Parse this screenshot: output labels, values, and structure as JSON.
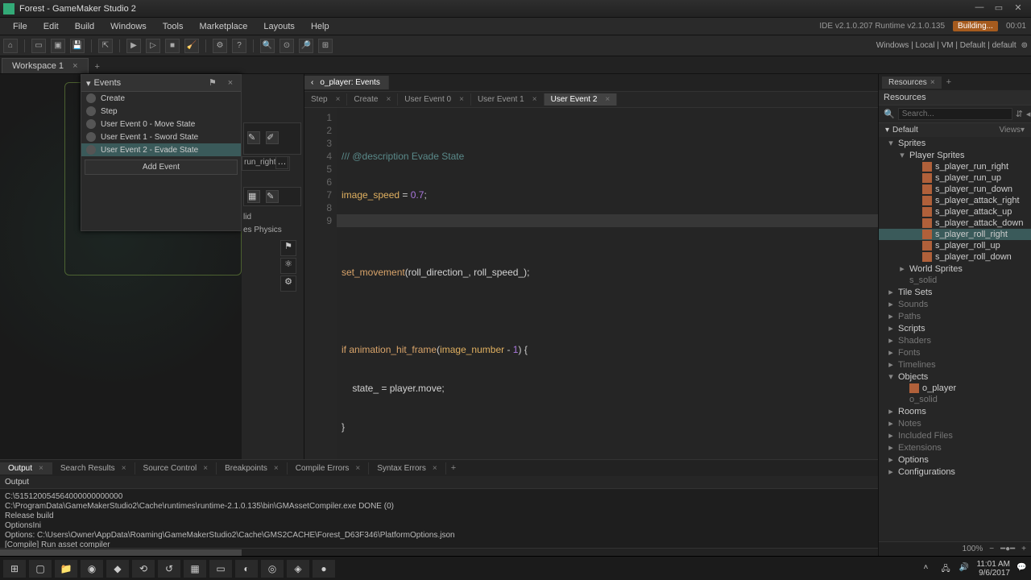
{
  "title": "Forest - GameMaker Studio 2",
  "menu": [
    "File",
    "Edit",
    "Build",
    "Windows",
    "Tools",
    "Marketplace",
    "Layouts",
    "Help"
  ],
  "status": {
    "ide": "IDE v2.1.0.207 Runtime v2.1.0.135",
    "building": "Building...",
    "timer": "00:01"
  },
  "target_info": "Windows | Local | VM | Default | default",
  "workspace_tab": "Workspace 1",
  "events": {
    "title": "Events",
    "items": [
      {
        "label": "Create"
      },
      {
        "label": "Step"
      },
      {
        "label": "User Event 0 - Move State"
      },
      {
        "label": "User Event 1 - Sword State"
      },
      {
        "label": "User Event 2 - Evade State",
        "active": true
      }
    ],
    "add": "Add Event"
  },
  "left": {
    "sprite_label": "run_right",
    "frag_solid": "lid",
    "frag_physics": "es Physics"
  },
  "editor": {
    "file_tab": "o_player: Events",
    "tabs": [
      {
        "label": "Step"
      },
      {
        "label": "Create"
      },
      {
        "label": "User Event 0"
      },
      {
        "label": "User Event 1"
      },
      {
        "label": "User Event 2",
        "active": true
      }
    ],
    "lines": [
      1,
      2,
      3,
      4,
      5,
      6,
      7,
      8,
      9
    ]
  },
  "code": {
    "l1": "/// @description Evade State",
    "l2a": "image_speed",
    "l2b": " = ",
    "l2c": "0.7",
    "l2d": ";",
    "l4a": "set_movement",
    "l4b": "(roll_direction_, roll_speed_);",
    "l6a": "if ",
    "l6b": "animation_hit_frame",
    "l6c": "(",
    "l6d": "image_number",
    "l6e": " - ",
    "l6f": "1",
    "l6g": ") {",
    "l7a": "    state_ = player.move;",
    "l8": "}"
  },
  "resources": {
    "title": "Resources",
    "header": "Resources",
    "search_ph": "Search...",
    "default": "Default",
    "views": "Views",
    "tree": [
      {
        "label": "Sprites",
        "level": 1,
        "caret": "▾"
      },
      {
        "label": "Player Sprites",
        "level": 2,
        "caret": "▾"
      },
      {
        "label": "s_player_run_right",
        "level": 3,
        "icon": true
      },
      {
        "label": "s_player_run_up",
        "level": 3,
        "icon": true
      },
      {
        "label": "s_player_run_down",
        "level": 3,
        "icon": true
      },
      {
        "label": "s_player_attack_right",
        "level": 3,
        "icon": true
      },
      {
        "label": "s_player_attack_up",
        "level": 3,
        "icon": true
      },
      {
        "label": "s_player_attack_down",
        "level": 3,
        "icon": true
      },
      {
        "label": "s_player_roll_right",
        "level": 3,
        "icon": true,
        "selected": true
      },
      {
        "label": "s_player_roll_up",
        "level": 3,
        "icon": true
      },
      {
        "label": "s_player_roll_down",
        "level": 3,
        "icon": true
      },
      {
        "label": "World Sprites",
        "level": 2,
        "caret": "▸"
      },
      {
        "label": "s_solid",
        "level": 2,
        "dim": true
      },
      {
        "label": "Tile Sets",
        "level": 1,
        "caret": "▸"
      },
      {
        "label": "Sounds",
        "level": 1,
        "caret": "▸",
        "dim": true
      },
      {
        "label": "Paths",
        "level": 1,
        "caret": "▸",
        "dim": true
      },
      {
        "label": "Scripts",
        "level": 1,
        "caret": "▸"
      },
      {
        "label": "Shaders",
        "level": 1,
        "caret": "▸",
        "dim": true
      },
      {
        "label": "Fonts",
        "level": 1,
        "caret": "▸",
        "dim": true
      },
      {
        "label": "Timelines",
        "level": 1,
        "caret": "▸",
        "dim": true
      },
      {
        "label": "Objects",
        "level": 1,
        "caret": "▾"
      },
      {
        "label": "o_player",
        "level": 2,
        "icon": true
      },
      {
        "label": "o_solid",
        "level": 2,
        "dim": true
      },
      {
        "label": "Rooms",
        "level": 1,
        "caret": "▸"
      },
      {
        "label": "Notes",
        "level": 1,
        "caret": "▸",
        "dim": true
      },
      {
        "label": "Included Files",
        "level": 1,
        "caret": "▸",
        "dim": true
      },
      {
        "label": "Extensions",
        "level": 1,
        "caret": "▸",
        "dim": true
      },
      {
        "label": "Options",
        "level": 1,
        "caret": "▸"
      },
      {
        "label": "Configurations",
        "level": 1,
        "caret": "▸"
      }
    ],
    "zoom": "100%"
  },
  "output": {
    "tabs": [
      "Output",
      "Search Results",
      "Source Control",
      "Breakpoints",
      "Compile Errors",
      "Syntax Errors"
    ],
    "header": "Output",
    "lines": [
      "C:\\515120054564000000000000",
      "C:\\ProgramData\\GameMakerStudio2\\Cache\\runtimes\\runtime-2.1.0.135\\bin\\GMAssetCompiler.exe DONE (0)",
      "Release build",
      "OptionsIni",
      "Options: C:\\Users\\Owner\\AppData\\Roaming\\GameMakerStudio2\\Cache\\GMS2CACHE\\Forest_D63F346\\PlatformOptions.json",
      "[Compile] Run asset compiler"
    ]
  },
  "tray": {
    "time": "11:01 AM",
    "date": "9/6/2017"
  }
}
